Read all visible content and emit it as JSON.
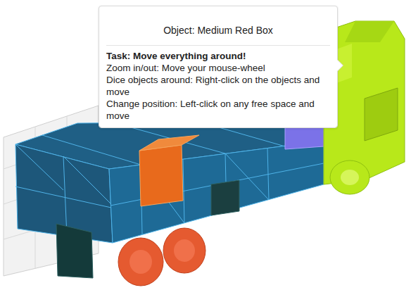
{
  "popover": {
    "title": "Object: Medium Red Box",
    "task": "Task: Move everything around!",
    "instructions": [
      "Zoom in/out: Move your mouse-wheel",
      "Dice objects around: Right-click on the objects and move",
      "Change position: Left-click on any free space and move"
    ]
  }
}
